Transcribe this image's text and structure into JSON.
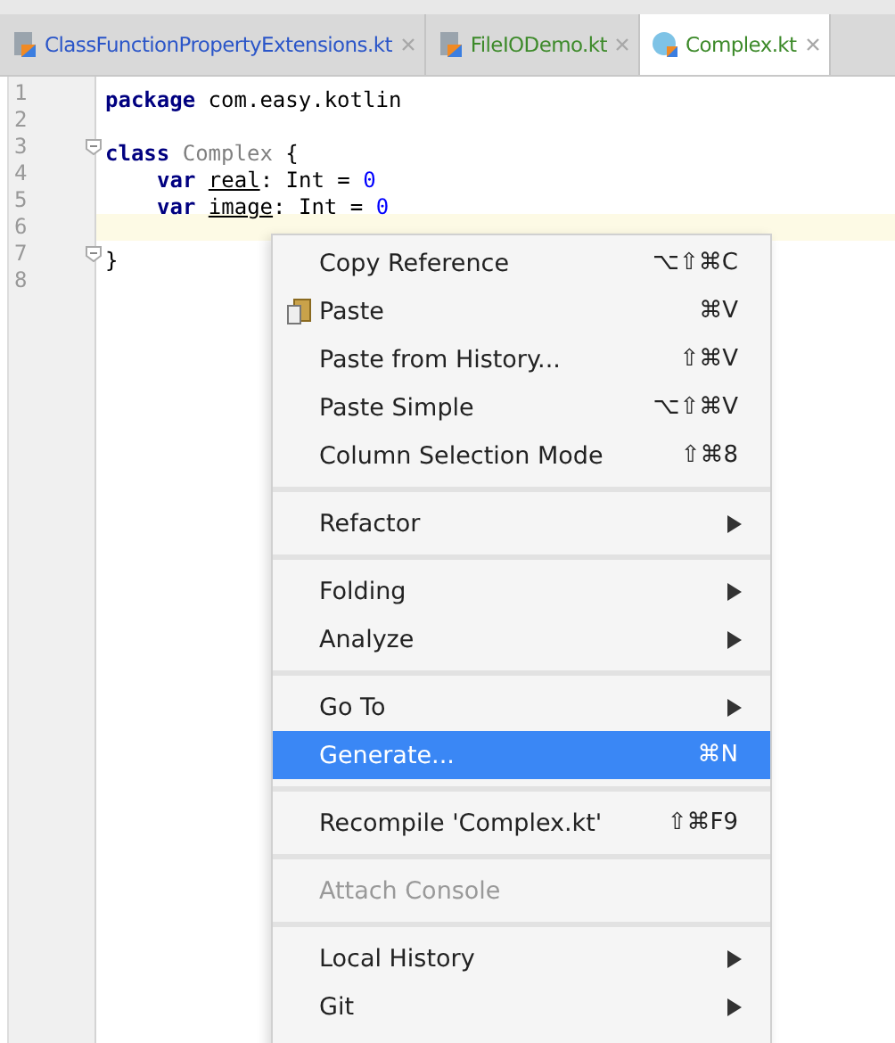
{
  "tabs": [
    {
      "label": "ClassFunctionPropertyExtensions.kt",
      "kind": "file",
      "color": "#2a55c8",
      "selected": false
    },
    {
      "label": "FileIODemo.kt",
      "kind": "file",
      "color": "#3d8a2a",
      "selected": false
    },
    {
      "label": "Complex.kt",
      "kind": "class",
      "color": "#3d8a2a",
      "selected": true
    }
  ],
  "editor": {
    "lines": [
      {
        "number": "1",
        "current": false,
        "fold": false,
        "indented": false,
        "tokens": [
          {
            "kind": "keyword",
            "text": "package"
          },
          {
            "kind": "plain",
            "text": "com.easy.kotlin"
          }
        ]
      },
      {
        "number": "2",
        "current": false,
        "fold": false,
        "indented": false
      },
      {
        "number": "3",
        "current": false,
        "fold": true,
        "indented": false,
        "tokens": [
          {
            "kind": "keyword",
            "text": "class"
          },
          {
            "kind": "unused",
            "text": "Complex"
          },
          {
            "kind": "plain",
            "text": " {"
          }
        ]
      },
      {
        "number": "4",
        "current": false,
        "fold": false,
        "indented": true,
        "tokens": [
          {
            "kind": "keyword",
            "text": "var"
          },
          {
            "kind": "property",
            "text": "real"
          },
          {
            "kind": "plain",
            "text": ": Int = "
          },
          {
            "kind": "number",
            "text": "0"
          }
        ]
      },
      {
        "number": "5",
        "current": false,
        "fold": false,
        "indented": true,
        "tokens": [
          {
            "kind": "keyword",
            "text": "var"
          },
          {
            "kind": "property",
            "text": "image"
          },
          {
            "kind": "plain",
            "text": ": Int = "
          },
          {
            "kind": "number",
            "text": "0"
          }
        ]
      },
      {
        "number": "6",
        "current": true,
        "fold": false,
        "indented": false
      },
      {
        "number": "7",
        "current": false,
        "fold": true,
        "indented": false,
        "tokens": [
          {
            "kind": "plain",
            "text": "}"
          }
        ]
      },
      {
        "number": "8",
        "current": false,
        "fold": false,
        "indented": false
      }
    ]
  },
  "context_menu": {
    "groups": [
      [
        {
          "label": "Copy Reference",
          "shortcut": "⌥⇧⌘C",
          "submenu": false,
          "disabled": false,
          "selected": false
        },
        {
          "label": "Paste",
          "shortcut": "⌘V",
          "submenu": false,
          "disabled": false,
          "selected": false
        },
        {
          "label": "Paste from History...",
          "shortcut": "⇧⌘V",
          "submenu": false,
          "disabled": false,
          "selected": false
        },
        {
          "label": "Paste Simple",
          "shortcut": "⌥⇧⌘V",
          "submenu": false,
          "disabled": false,
          "selected": false
        },
        {
          "label": "Column Selection Mode",
          "shortcut": "⇧⌘8",
          "submenu": false,
          "disabled": false,
          "selected": false
        }
      ],
      [
        {
          "label": "Refactor",
          "submenu": true,
          "disabled": false,
          "selected": false
        }
      ],
      [
        {
          "label": "Folding",
          "submenu": true,
          "disabled": false,
          "selected": false
        },
        {
          "label": "Analyze",
          "submenu": true,
          "disabled": false,
          "selected": false
        }
      ],
      [
        {
          "label": "Go To",
          "submenu": true,
          "disabled": false,
          "selected": false
        },
        {
          "label": "Generate...",
          "shortcut": "⌘N",
          "submenu": false,
          "disabled": false,
          "selected": true
        }
      ],
      [
        {
          "label": "Recompile 'Complex.kt'",
          "shortcut": "⇧⌘F9",
          "submenu": false,
          "disabled": false,
          "selected": false
        }
      ],
      [
        {
          "label": "Attach Console",
          "submenu": false,
          "disabled": true,
          "selected": false
        }
      ],
      [
        {
          "label": "Local History",
          "submenu": true,
          "disabled": false,
          "selected": false
        },
        {
          "label": "Git",
          "submenu": true,
          "disabled": false,
          "selected": false
        }
      ]
    ]
  }
}
